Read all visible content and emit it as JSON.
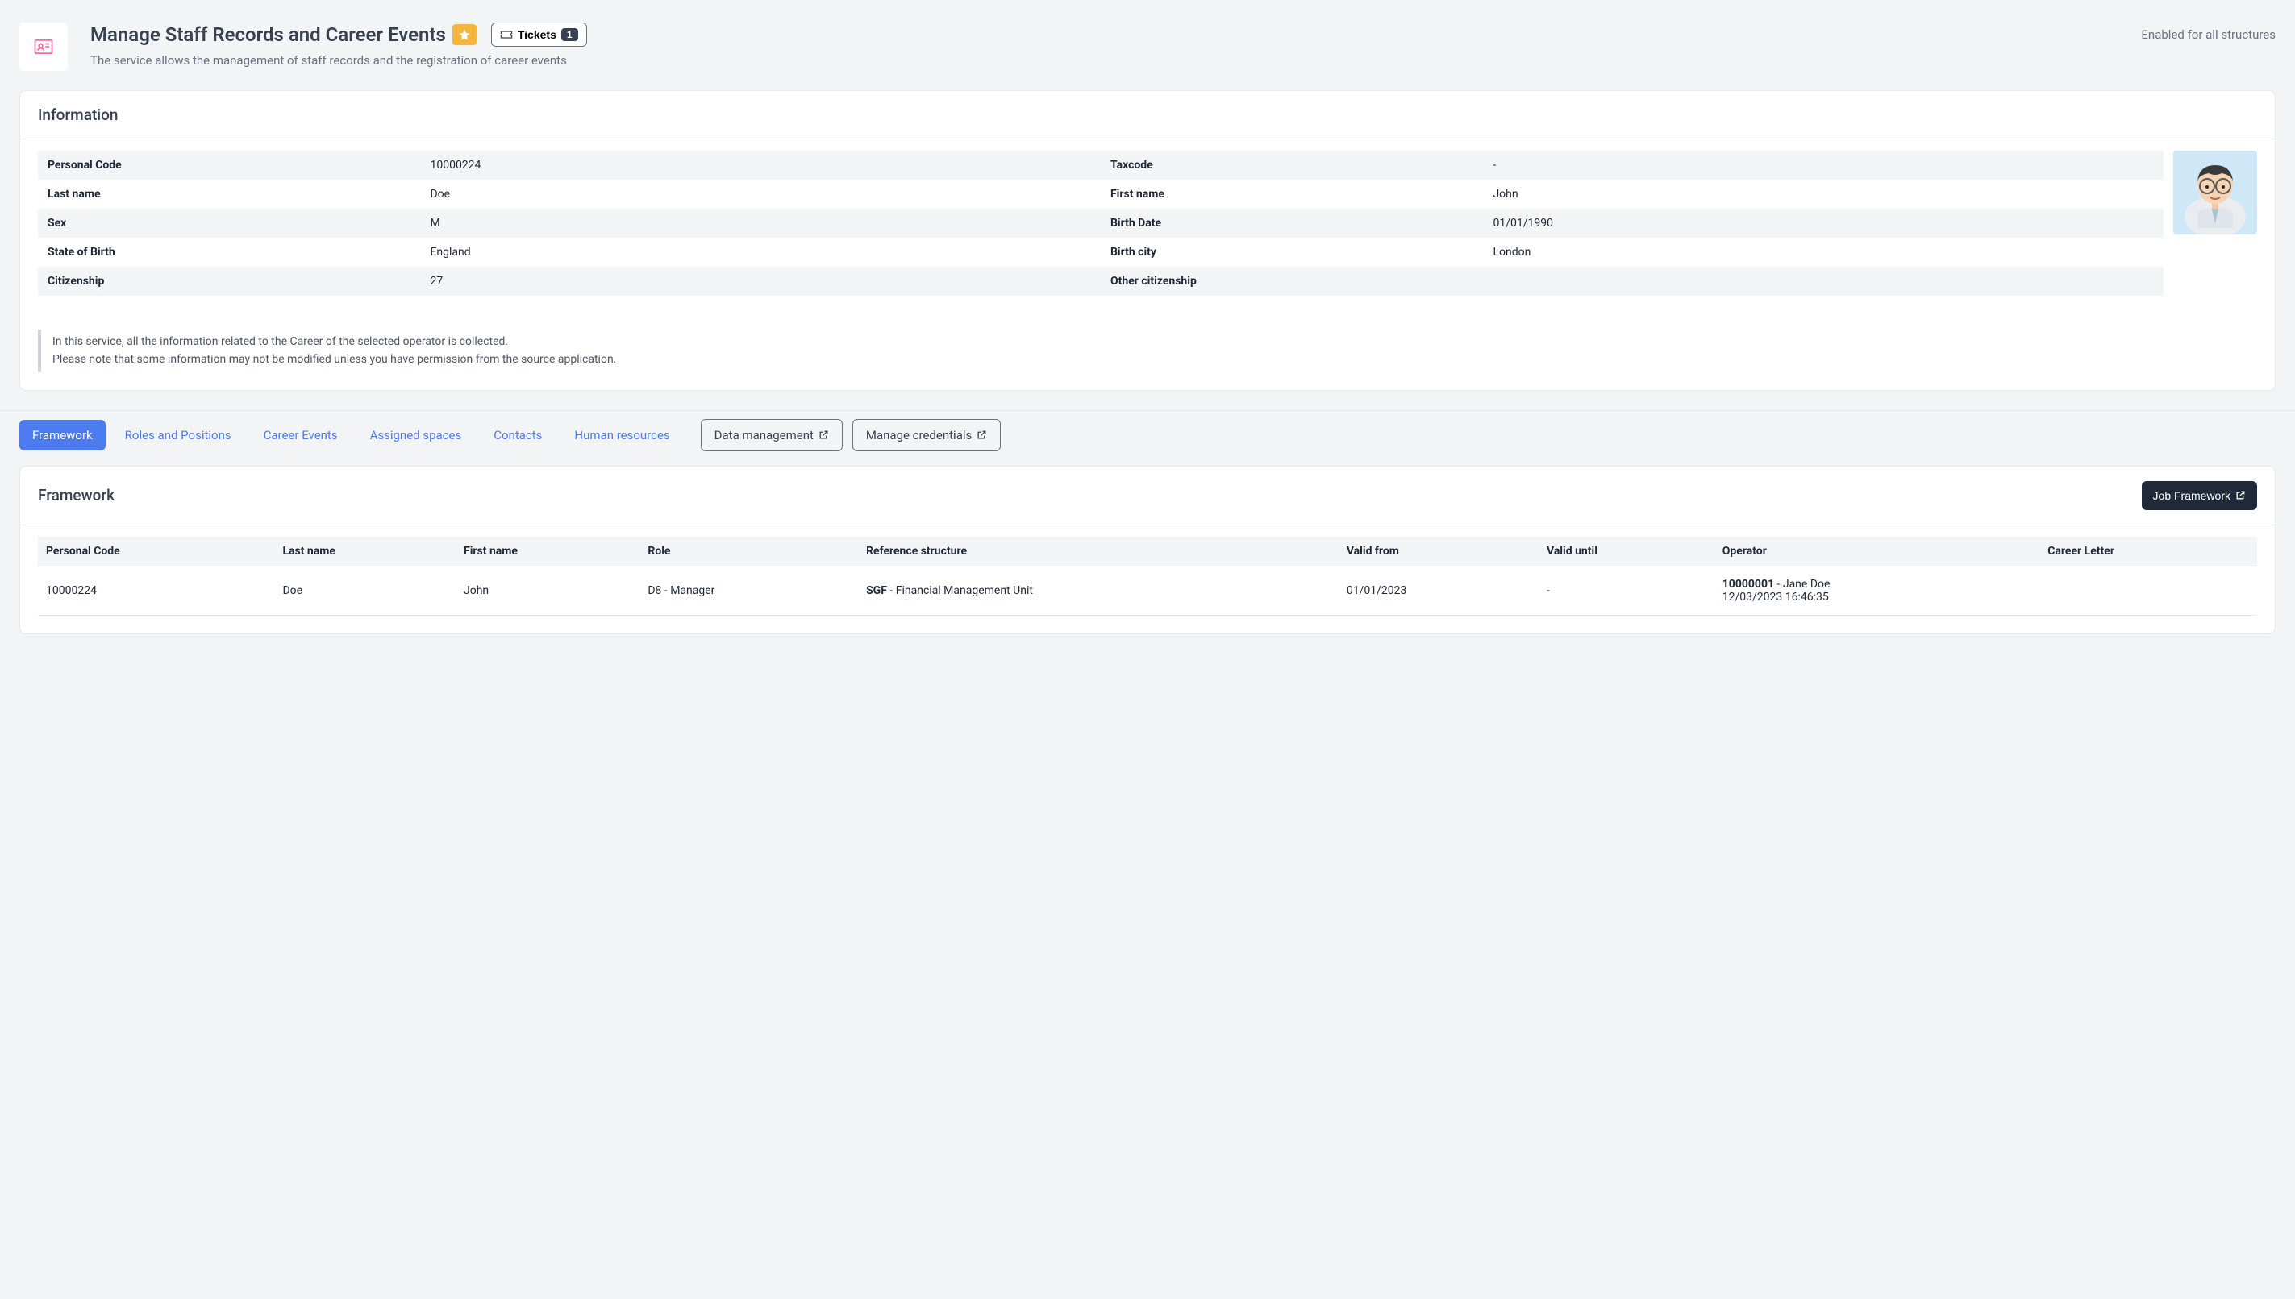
{
  "header": {
    "title": "Manage Staff Records and Career Events",
    "description": "The service allows the management of staff records and the registration of career events",
    "tickets_label": "Tickets",
    "tickets_count": "1",
    "right_text": "Enabled for all structures"
  },
  "info_card": {
    "title": "Information",
    "rows": [
      {
        "l1": "Personal Code",
        "v1": "10000224",
        "l2": "Taxcode",
        "v2": "-"
      },
      {
        "l1": "Last name",
        "v1": "Doe",
        "l2": "First name",
        "v2": "John"
      },
      {
        "l1": "Sex",
        "v1": "M",
        "l2": "Birth Date",
        "v2": "01/01/1990"
      },
      {
        "l1": "State of Birth",
        "v1": "England",
        "l2": "Birth city",
        "v2": "London"
      },
      {
        "l1": "Citizenship",
        "v1": "27",
        "l2": "Other citizenship",
        "v2": ""
      }
    ],
    "note_line1": "In this service, all the information related to the Career of the selected operator is collected.",
    "note_line2": "Please note that some information may not be modified unless you have permission from the source application."
  },
  "tabs": {
    "framework": "Framework",
    "roles": "Roles and Positions",
    "career": "Career Events",
    "assigned": "Assigned spaces",
    "contacts": "Contacts",
    "hr": "Human resources",
    "data_mgmt": "Data management",
    "manage_cred": "Manage credentials"
  },
  "framework_card": {
    "title": "Framework",
    "job_button": "Job Framework",
    "columns": {
      "personal_code": "Personal Code",
      "last_name": "Last name",
      "first_name": "First name",
      "role": "Role",
      "ref_struct": "Reference structure",
      "valid_from": "Valid from",
      "valid_until": "Valid until",
      "operator": "Operator",
      "career_letter": "Career Letter"
    },
    "row": {
      "personal_code": "10000224",
      "last_name": "Doe",
      "first_name": "John",
      "role": "D8 - Manager",
      "rs_code": "SGF",
      "rs_name": " - Financial Management Unit",
      "valid_from": "01/01/2023",
      "valid_until": "-",
      "op_code": "10000001",
      "op_name": " - Jane Doe",
      "op_date": "12/03/2023 16:46:35",
      "career_letter": ""
    }
  }
}
